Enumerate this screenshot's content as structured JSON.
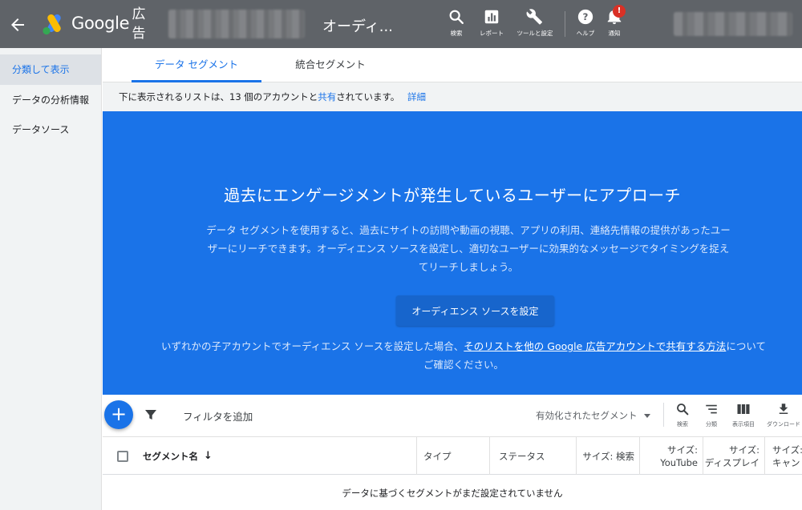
{
  "header": {
    "brand": "Google",
    "brand_suffix": "広告",
    "page_title": "オーディ...",
    "tools": [
      {
        "label": "検索",
        "icon": "search-icon"
      },
      {
        "label": "レポート",
        "icon": "report-icon"
      },
      {
        "label": "ツールと設定",
        "icon": "wrench-icon"
      },
      {
        "label": "ヘルプ",
        "icon": "help-icon"
      },
      {
        "label": "通知",
        "icon": "bell-icon",
        "badge": "!"
      }
    ]
  },
  "sidebar": {
    "items": [
      {
        "label": "分類して表示",
        "active": true
      },
      {
        "label": "データの分析情報",
        "active": false
      },
      {
        "label": "データソース",
        "active": false
      }
    ]
  },
  "tabs": [
    {
      "label": "データ セグメント",
      "active": true
    },
    {
      "label": "統合セグメント",
      "active": false
    }
  ],
  "shared_note": {
    "before": "下に表示されるリストは、13 個のアカウントと",
    "link": "共有",
    "after": "されています。",
    "details_link": "詳細"
  },
  "hero": {
    "title": "過去にエンゲージメントが発生しているユーザーにアプローチ",
    "description": "データ セグメントを使用すると、過去にサイトの訪問や動画の視聴、アプリの利用、連絡先情報の提供があったユーザーにリーチできます。オーディエンス ソースを設定し、適切なユーザーに効果的なメッセージでタイミングを捉えてリーチしましょう。",
    "button": "オーディエンス ソースを設定",
    "footer_before": "いずれかの子アカウントでオーディエンス ソースを設定した場合、",
    "footer_link": "そのリストを他の Google 広告アカウントで共有する方法",
    "footer_after": "についてご確認ください。"
  },
  "filter_bar": {
    "add_icon": "plus-icon",
    "filter_label": "フィルタを追加",
    "segment_select": "有効化されたセグメント",
    "tools": [
      {
        "label": "検索",
        "icon": "search-icon"
      },
      {
        "label": "分類",
        "icon": "segment-icon"
      },
      {
        "label": "表示項目",
        "icon": "columns-icon"
      },
      {
        "label": "ダウンロード",
        "icon": "download-icon"
      }
    ]
  },
  "table": {
    "columns": {
      "name": "セグメント名",
      "type": "タイプ",
      "status": "ステータス",
      "size_search": "サイズ: 検索",
      "size_youtube_1": "サイズ:",
      "size_youtube_2": "YouTube",
      "size_display_1": "サイズ:",
      "size_display_2": "ディスプレイ",
      "size_cannes_1": "サイズ:",
      "size_cannes_2": "キャン"
    },
    "empty_message": "データに基づくセグメントがまだ設定されていません"
  },
  "colors": {
    "topbar": "#5f6368",
    "accent": "#1a73e8",
    "hero": "#1a73e8",
    "sidebar": "#f1f3f4"
  }
}
